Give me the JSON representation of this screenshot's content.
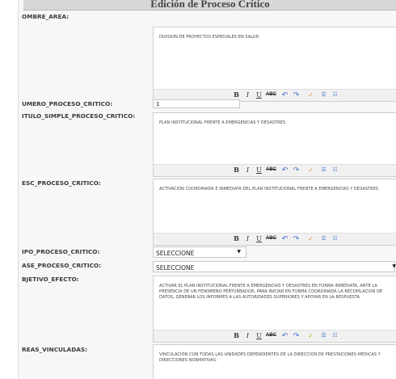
{
  "page": {
    "title": "Edición de Proceso Crítico"
  },
  "fields": {
    "nombre_area": {
      "label": "OMBRE_AREA:",
      "value": "DIVISION DE PROYECTOS ESPECIALES EN SALUD"
    },
    "numero_proceso": {
      "label": "UMERO_PROCESO_CRITICO:",
      "value": "1"
    },
    "titulo_simple": {
      "label": "ITULO_SIMPLE_PROCESO_CRITICO:",
      "value": "PLAN INSTITUCIONAL FRENTE A EMERGENCIAS Y DESASTRES"
    },
    "desc_proceso": {
      "label": "ESC_PROCESO_CRITICO:",
      "value": "ACTIVACIÓN COORDINADA E INMEDIATA DEL PLAN INSTITUCIONAL FRENTE A EMERGENCIAS Y DESASTRES"
    },
    "tipo_proceso": {
      "label": "IPO_PROCESO_CRITICO:",
      "selected": "SELECCIONE"
    },
    "fase_proceso": {
      "label": "ASE_PROCESO_CRITICO:",
      "selected": "SELECCIONE"
    },
    "objetivo_efecto": {
      "label": "BJETIVO_EFECTO:",
      "value": "ACTIVAR EL PLAN INSTITUCIONAL FRENTE A EMERGENCIAS Y DESASTRES EN FORMA INMEDIATA, ANTE LA PRESENCIA DE UN FENOMENO PERTURBADOR, PARA INICIAR EN FORMA COORDINADA LA RECOPILACION DE DATOS, GENERAR LOS INFORMES A LAS AUTORIDADES SUPERIORES Y APOYAR EN LA RESPUESTA."
    },
    "areas_vinculadas": {
      "label": "REAS_VINCULADAS:",
      "value": "VINCULACIÓN CON TODAS LAS UNIDADES DEPENDIENTES DE LA DIRECCION DE PRESTACIONES MEDICAS Y DIRECCIONES NORMATIVAS."
    }
  },
  "toolbar": {
    "bold": "B",
    "italic": "I",
    "underline": "U",
    "strike": "ABC",
    "undo": "↶",
    "redo": "↷",
    "spell": "✓",
    "bullets": "☰",
    "numbers": "☷"
  },
  "icons": {
    "dropdown_arrow": "▼"
  }
}
